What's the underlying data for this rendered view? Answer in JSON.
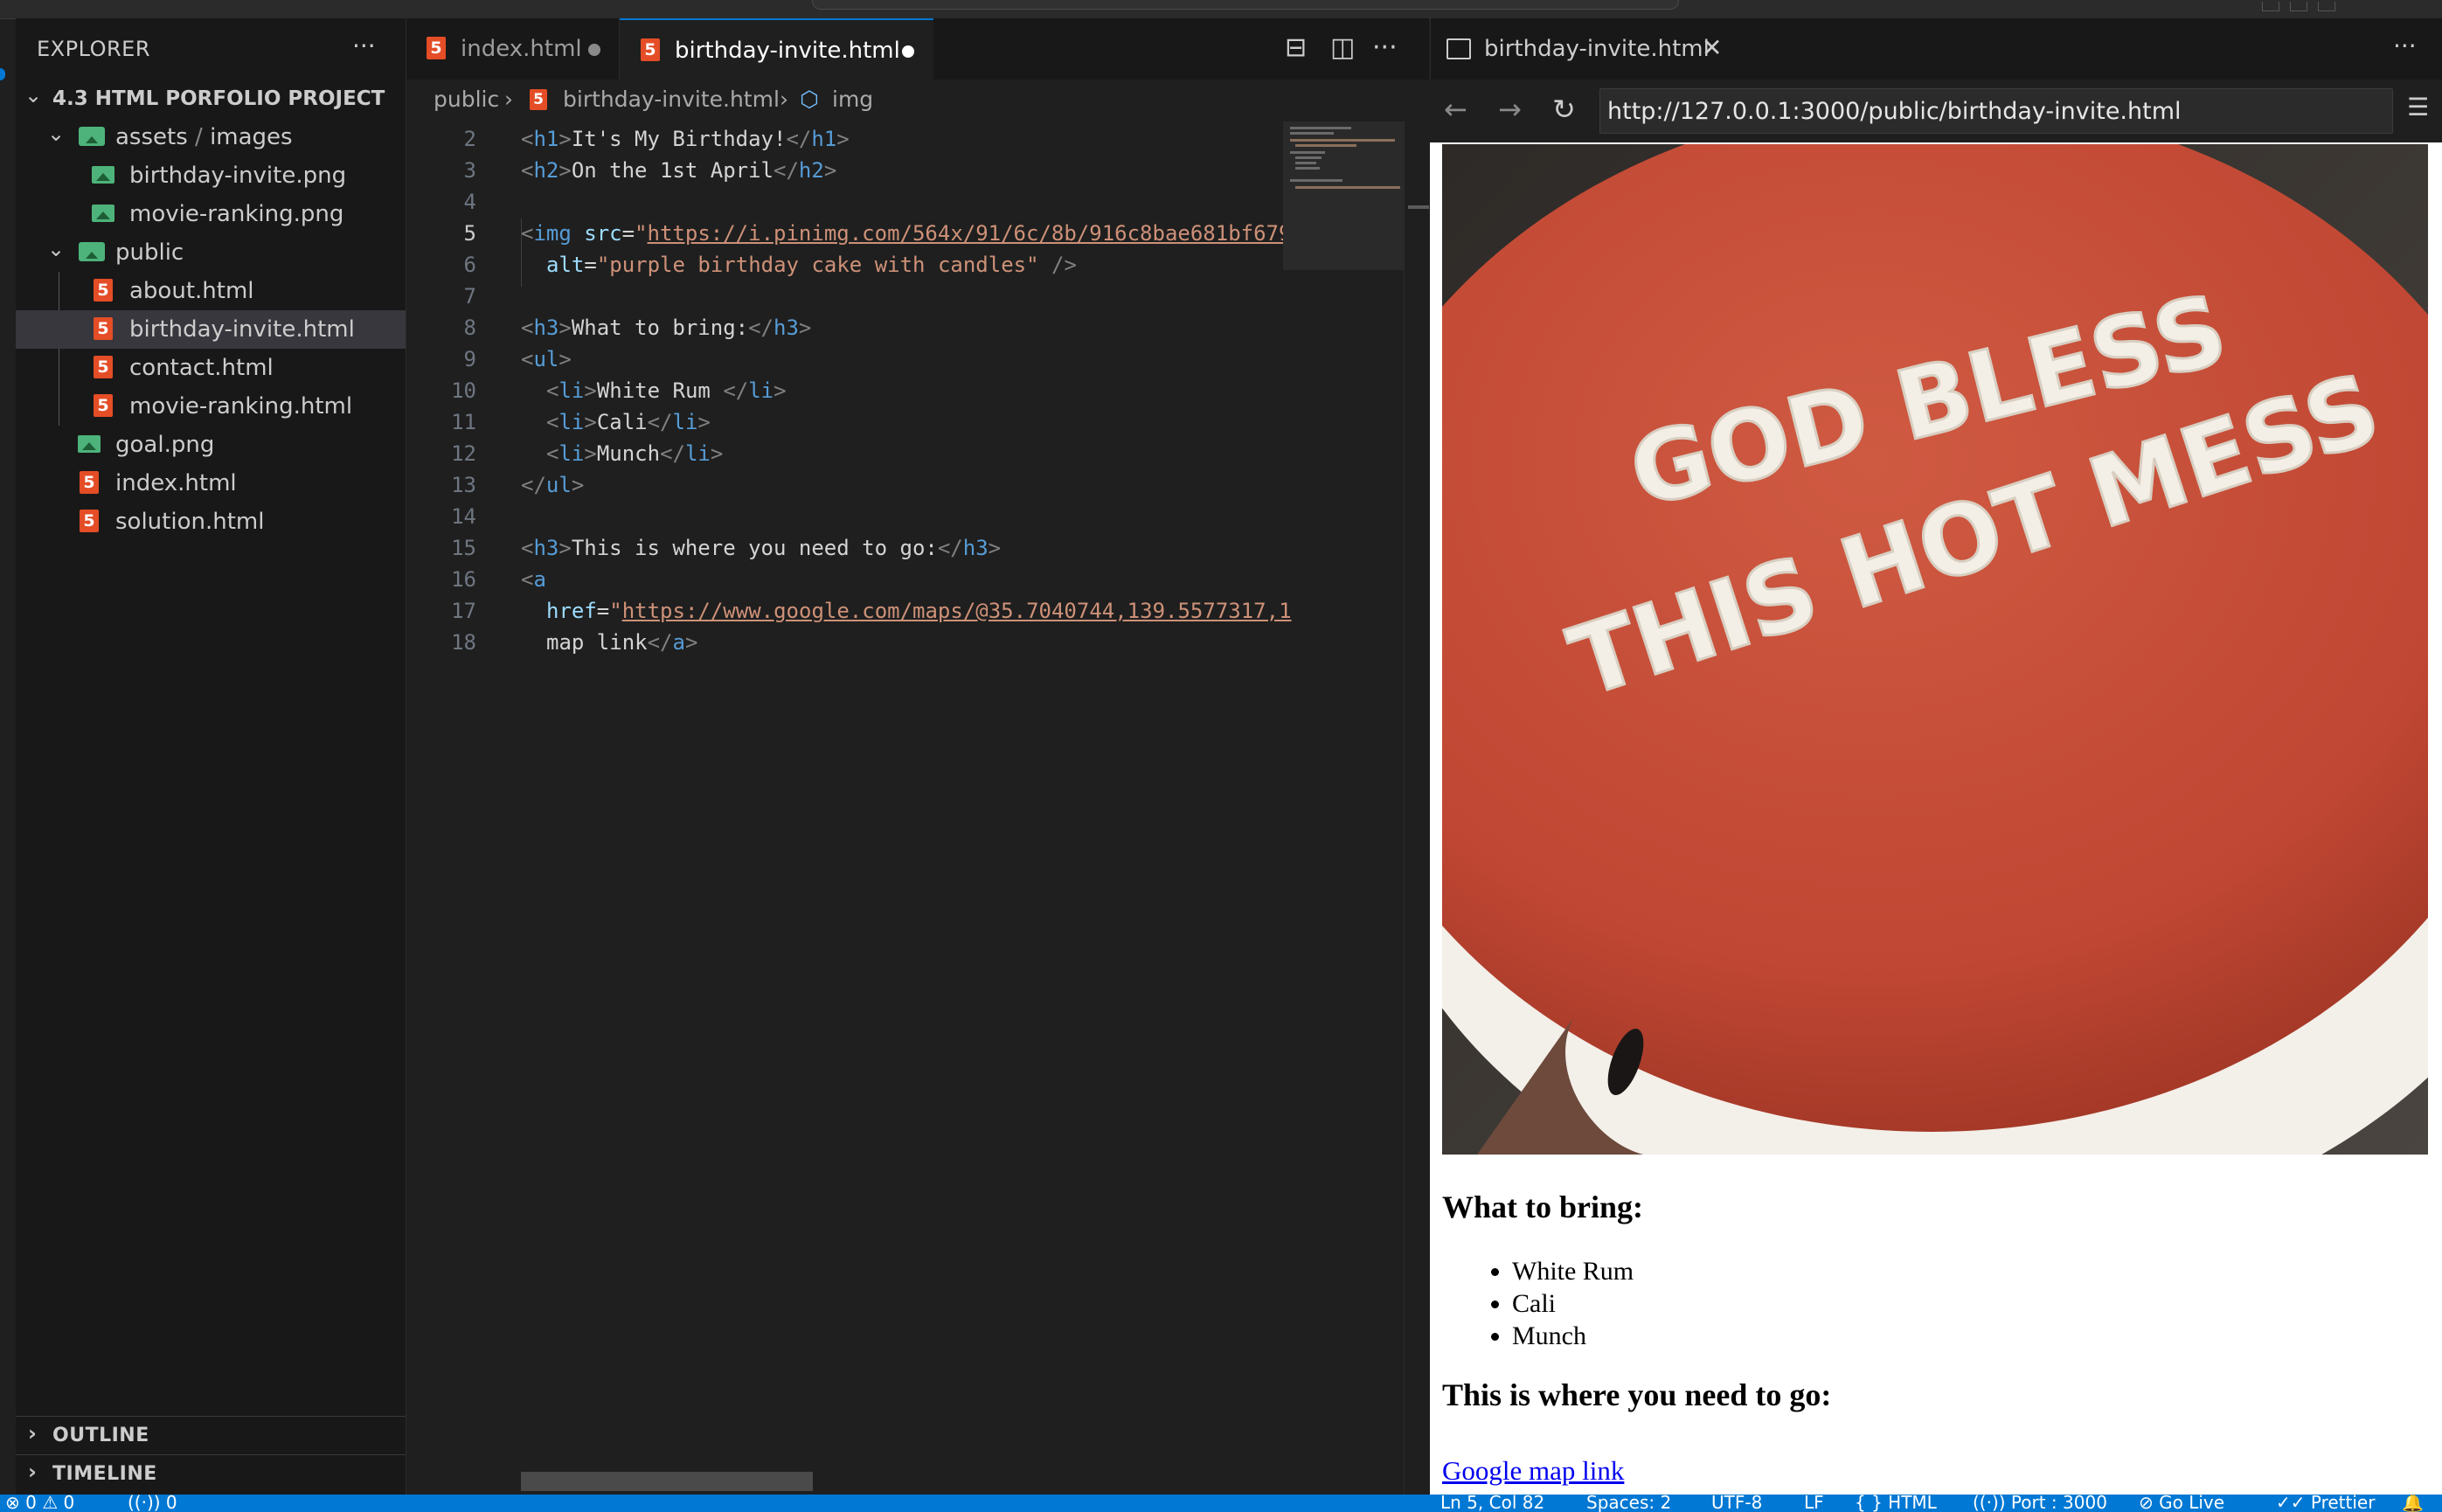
{
  "sidebar": {
    "title": "EXPLORER",
    "project": "4.3 HTML PORFOLIO PROJECT",
    "tree": {
      "assets": "assets",
      "images": "images",
      "birthday_invite_png": "birthday-invite.png",
      "movie_ranking_png": "movie-ranking.png",
      "public": "public",
      "about_html": "about.html",
      "birthday_invite_html": "birthday-invite.html",
      "contact_html": "contact.html",
      "movie_ranking_html": "movie-ranking.html",
      "goal_png": "goal.png",
      "index_html": "index.html",
      "solution_html": "solution.html"
    },
    "outline": "OUTLINE",
    "timeline": "TIMELINE"
  },
  "editor": {
    "tabs": [
      {
        "label": "index.html",
        "modified": true,
        "active": false
      },
      {
        "label": "birthday-invite.html",
        "modified": true,
        "active": true
      }
    ],
    "breadcrumb": [
      "public",
      "birthday-invite.html",
      "img"
    ],
    "lines": [
      {
        "n": "2",
        "t": [
          "<h1>",
          "It's My Birthday!",
          "</h1>"
        ]
      },
      {
        "n": "3",
        "t": [
          "<h2>",
          "On the 1st April",
          "</h2>"
        ]
      },
      {
        "n": "4"
      },
      {
        "n": "5",
        "src": "https://i.pinimg.com/564x/91/6c/8b/916c8bae681bf679"
      },
      {
        "n": "6",
        "alt": "\"purple birthday cake with candles\""
      },
      {
        "n": "7"
      },
      {
        "n": "8",
        "t": [
          "<h3>",
          "What to bring:",
          "</h3>"
        ]
      },
      {
        "n": "9"
      },
      {
        "n": "10",
        "t": [
          "<li>",
          "White Rum ",
          "</li>"
        ]
      },
      {
        "n": "11",
        "t": [
          "<li>",
          "Cali",
          "</li>"
        ]
      },
      {
        "n": "12",
        "t": [
          "<li>",
          "Munch",
          "</li>"
        ]
      },
      {
        "n": "13"
      },
      {
        "n": "14"
      },
      {
        "n": "15",
        "t": [
          "<h3>",
          "This is where you need to go:",
          "</h3>"
        ]
      },
      {
        "n": "16"
      },
      {
        "n": "17",
        "href": "https://www.google.com/maps/@35.7040744,139.5577317,1"
      },
      {
        "n": "18",
        "tail": "map link"
      }
    ]
  },
  "preview": {
    "tab_title": "birthday-invite.html",
    "url": "http://127.0.0.1:3000/public/birthday-invite.html",
    "cake_text": [
      "GOD BLESS",
      "THIS HOT MESS"
    ],
    "bring_heading": "What to bring:",
    "bring_items": [
      "White Rum",
      "Cali",
      "Munch"
    ],
    "go_heading": "This is where you need to go:",
    "map_link": "Google map link"
  },
  "statusbar": {
    "problems": "⊗ 0 ⚠ 0",
    "ports": "((·)) 0",
    "cursor": "Ln 5, Col 82",
    "spaces": "Spaces: 2",
    "encoding": "UTF-8",
    "eol": "LF",
    "language": "{ } HTML",
    "port": "((·)) Port : 3000",
    "golive": "⊘ Go Live",
    "prettier": "✓✓ Prettier"
  },
  "colors": {
    "accent": "#0078d4",
    "html_icon": "#e44d26",
    "image_icon": "#4db37a",
    "cake_red": "#c44a36"
  }
}
